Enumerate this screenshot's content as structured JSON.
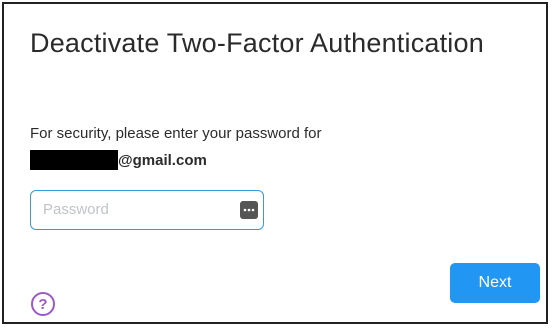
{
  "dialog": {
    "title": "Deactivate Two-Factor Authentication",
    "instruction": "For security, please enter your password for",
    "email_suffix": "@gmail.com"
  },
  "password_field": {
    "placeholder": "Password",
    "value": "",
    "autofill_icon": "password-keychain-icon"
  },
  "actions": {
    "next_label": "Next",
    "help_glyph": "?"
  },
  "colors": {
    "accent": "#2196f3",
    "input_border": "#3a9ad9",
    "help": "#9b59c6",
    "text": "#2b2b2b"
  }
}
